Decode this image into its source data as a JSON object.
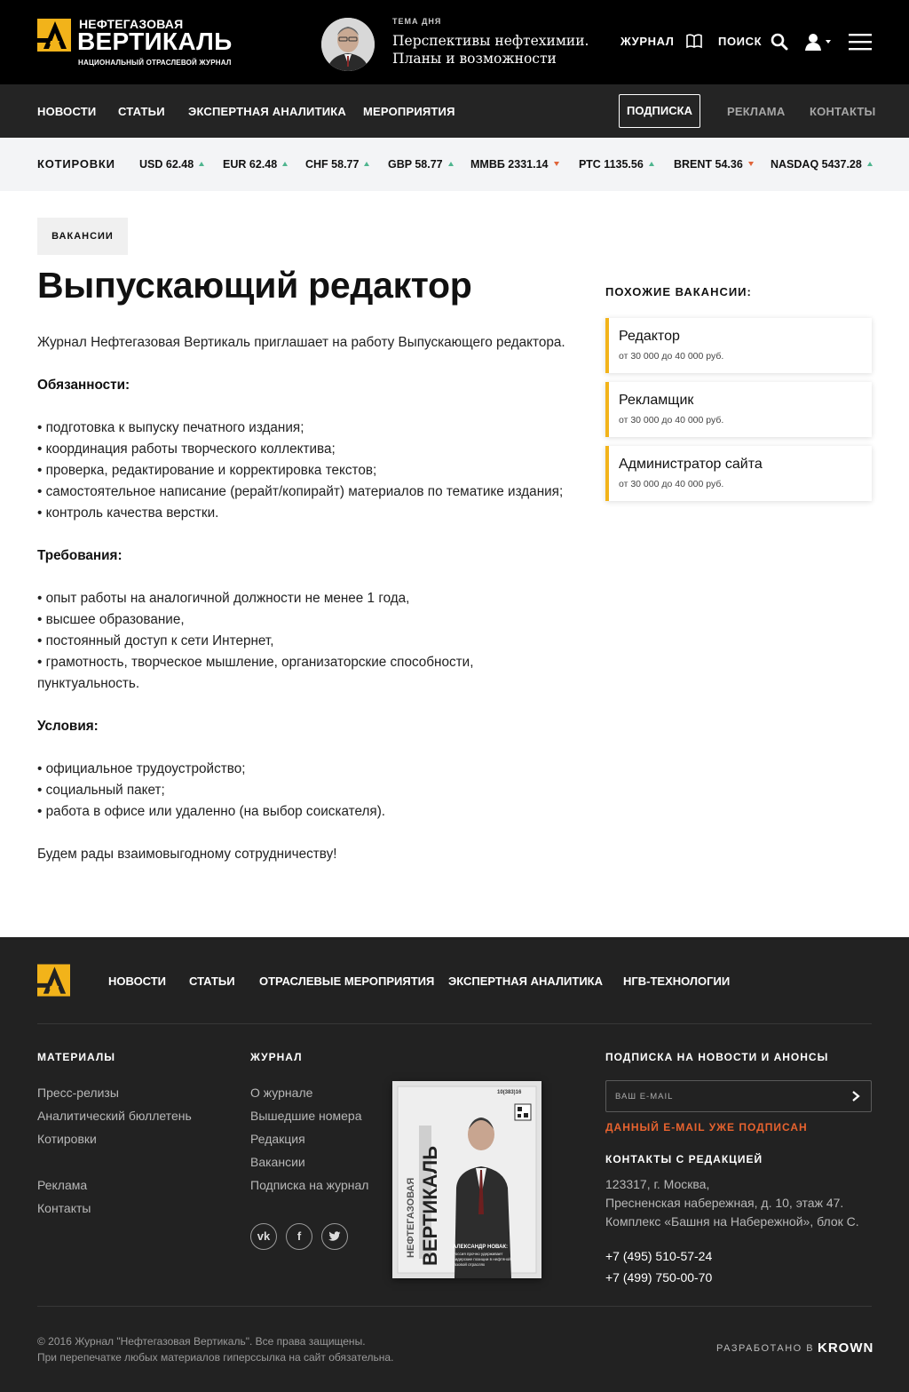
{
  "header": {
    "logo_top": "НЕФТЕГАЗОВАЯ",
    "logo_main": "ВЕРТИКАЛЬ",
    "logo_sub": "НАЦИОНАЛЬНЫЙ ОТРАСЛЕВОЙ ЖУРНАЛ",
    "topic_label": "ТЕМА ДНЯ",
    "topic_title": "Перспективы нефтехимии. Планы и возможности",
    "journal_label": "ЖУРНАЛ",
    "search_label": "ПОИСК",
    "icons": [
      "book-icon",
      "search-icon",
      "user-icon",
      "menu-icon"
    ]
  },
  "nav": {
    "items": [
      "НОВОСТИ",
      "СТАТЬИ",
      "ЭКСПЕРТНАЯ АНАЛИТИКА",
      "МЕРОПРИЯТИЯ"
    ],
    "subscribe": "ПОДПИСКА",
    "ads": "РЕКЛАМА",
    "contacts": "КОНТАКТЫ"
  },
  "quotes": {
    "label": "КОТИРОВКИ",
    "items": [
      {
        "text": "USD 62.48",
        "trend": "up"
      },
      {
        "text": "EUR 62.48",
        "trend": "up"
      },
      {
        "text": "CHF 58.77",
        "trend": "up"
      },
      {
        "text": "GBP 58.77",
        "trend": "up"
      },
      {
        "text": "ММВБ 2331.14",
        "trend": "down"
      },
      {
        "text": "РТС 1135.56",
        "trend": "up"
      },
      {
        "text": "BRENT 54.36",
        "trend": "down"
      },
      {
        "text": "NASDAQ 5437.28",
        "trend": "up"
      }
    ],
    "colors": {
      "up": "#4fb58f",
      "down": "#e0643a"
    }
  },
  "main": {
    "tag": "ВАКАНСИИ",
    "title": "Выпускающий редактор",
    "intro": "Журнал Нефтегазовая Вертикаль  приглашает на работу Выпускающего редактора.",
    "duties_title": "Обязанности:",
    "duties": [
      "• подготовка к выпуску печатного издания;",
      "• координация работы творческого коллектива;",
      "• проверка, редактирование и корректировка текстов;",
      "• самостоятельное написание (рерайт/копирайт) материалов по тематике издания;",
      "• контроль качества верстки."
    ],
    "req_title": "Требования:",
    "requirements": [
      "• опыт работы на аналогичной должности не менее 1 года,",
      "• высшее образование,",
      "• постоянный доступ к сети Интернет,",
      "• грамотность, творческое мышление, организаторские способности, пунктуальность."
    ],
    "cond_title": "Условия:",
    "conditions": [
      "• официальное трудоустройство;",
      "• социальный пакет;",
      "• работа в офисе или удаленно (на выбор соискателя)."
    ],
    "closing": "Будем рады взаимовыгодному сотрудничеству!"
  },
  "sidebar": {
    "title": "ПОХОЖИЕ ВАКАНСИИ:",
    "accent": "#f2b31a",
    "items": [
      {
        "title": "Редактор",
        "salary": "от 30 000 до 40 000 руб."
      },
      {
        "title": "Рекламщик",
        "salary": "от 30 000 до 40 000 руб."
      },
      {
        "title": "Администратор сайта",
        "salary": "от 30 000 до 40 000 руб."
      }
    ]
  },
  "footer": {
    "nav": [
      "НОВОСТИ",
      "СТАТЬИ",
      "ОТРАСЛЕВЫЕ МЕРОПРИЯТИЯ",
      "ЭКСПЕРТНАЯ АНАЛИТИКА",
      "НГВ-ТЕХНОЛОГИИ"
    ],
    "materials_title": "МАТЕРИАЛЫ",
    "materials": [
      "Пресс-релизы",
      "Аналитический бюллетень",
      "Котировки"
    ],
    "materials_extra": [
      "Реклама",
      "Контакты"
    ],
    "journal_title": "ЖУРНАЛ",
    "journal": [
      "О журнале",
      "Вышедшие номера",
      "Редакция",
      "Вакансии",
      "Подписка на журнал"
    ],
    "social": [
      "vk-icon",
      "facebook-icon",
      "twitter-icon"
    ],
    "cover": {
      "issue": "10(383)16",
      "title_top": "НЕФТЕГАЗОВАЯ",
      "title_main": "ВЕРТИКАЛЬ",
      "headline": "АЛЕКСАНДР НОВАК:",
      "subheadline": "Россия прочно удерживает лидерские позиции в нефтяной и газовой отраслях"
    },
    "subscribe_title": "ПОДПИСКА НА НОВОСТИ И АНОНСЫ",
    "email_placeholder": "ВАШ E-MAIL",
    "email_error": "ДАННЫЙ E-MAIL УЖЕ ПОДПИСАН",
    "contacts_title": "КОНТАКТЫ С РЕДАКЦИЕЙ",
    "address": [
      "123317, г. Москва,",
      "Пресненская набережная, д. 10, этаж 47.",
      "Комплекс «Башня на Набережной», блок С."
    ],
    "phones": [
      "+7 (495) 510-57-24",
      "+7 (499) 750-00-70"
    ],
    "copyright": [
      "© 2016 Журнал \"Нефтегазовая Вертикаль\". Все права защищены.",
      "При перепечатке любых материалов гиперссылка на сайт обязательна."
    ],
    "dev_label": "РАЗРАБОТАНО В",
    "dev_brand": "KROWN"
  }
}
